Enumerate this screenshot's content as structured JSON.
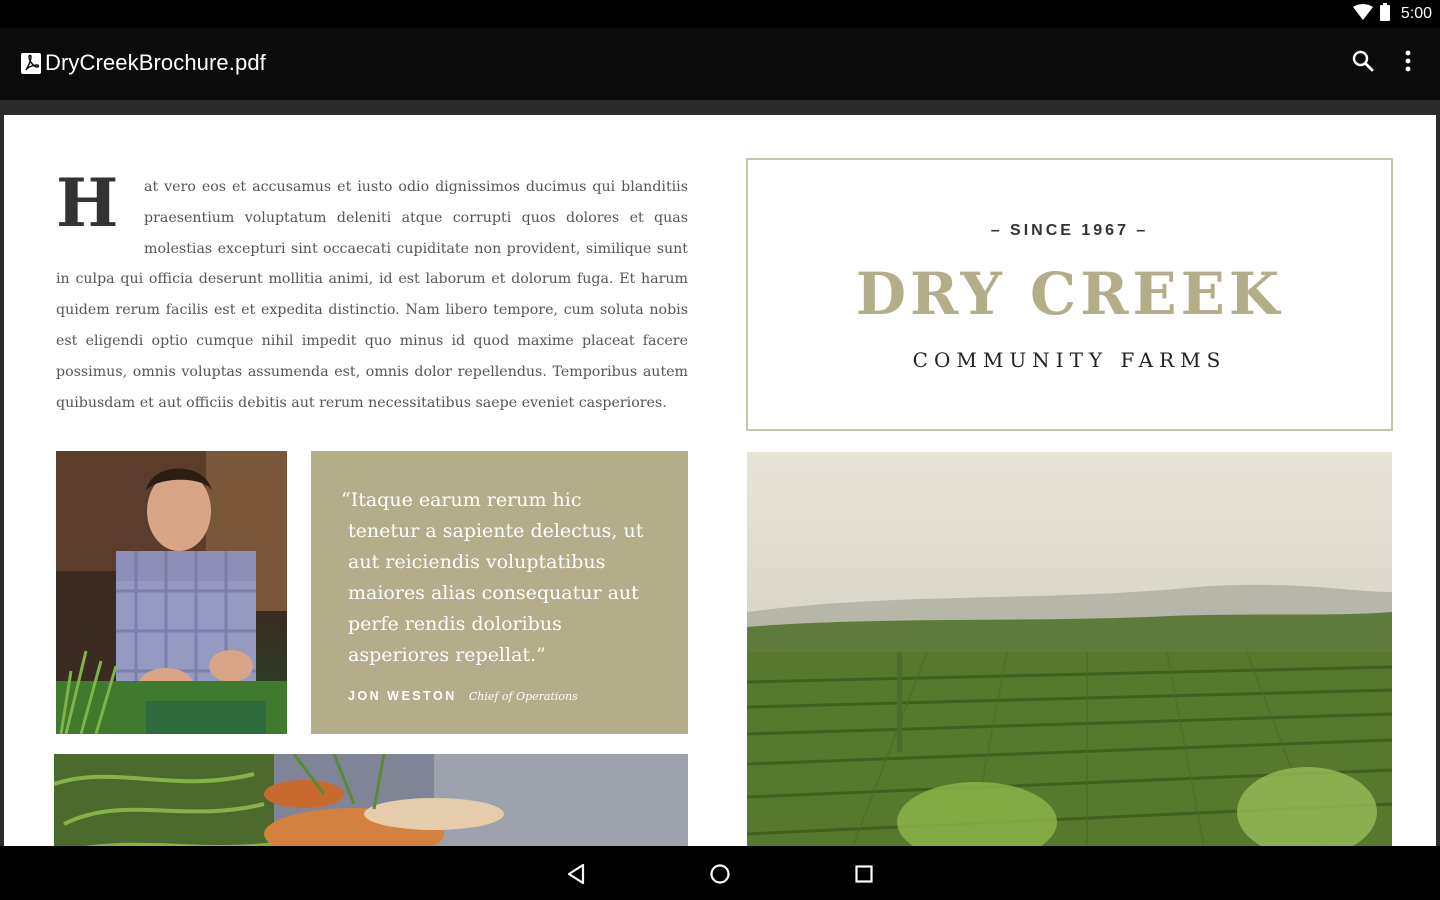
{
  "status_bar": {
    "time": "5:00",
    "icons": [
      "wifi-icon",
      "battery-icon"
    ]
  },
  "app_bar": {
    "file_icon": "pdf-icon",
    "title": "DryCreekBrochure.pdf",
    "actions": [
      "search-icon",
      "more-vert-icon"
    ]
  },
  "document": {
    "article": {
      "drop_cap": "H",
      "body": "at vero eos et accusamus et iusto odio dignissimos ducimus qui blanditiis praesentium voluptatum deleniti atque corrupti quos dolores et quas molestias excepturi sint occaecati cupiditate non provident, similique sunt in culpa qui officia deserunt mollitia animi, id est laborum et dolorum fuga. Et harum quidem rerum facilis est et expedita distinctio. Nam libero tempore, cum soluta nobis est eligendi optio cumque nihil impedit quo minus id quod maxime placeat facere possimus, omnis voluptas assumenda est, omnis dolor repellendus. Temporibus autem quibusdam et aut officiis debitis aut rerum necessitatibus saepe eveniet casperiores."
    },
    "quote": {
      "text": "“Itaque earum rerum hic tenetur a sapiente delectus, ut aut reiciendis voluptatibus maiores alias consequatur aut perfe rendis doloribus asperiores repellat.”",
      "name": "JON WESTON",
      "role": "Chief of Operations"
    },
    "logo": {
      "since": "– SINCE 1967 –",
      "name": "DRY CREEK",
      "subtitle": "COMMUNITY FARMS"
    },
    "colors": {
      "accent": "#b3ad89",
      "border": "#c9c4a6",
      "body_text": "#555555"
    }
  },
  "nav_bar": {
    "buttons": [
      "back-icon",
      "home-icon",
      "recents-icon"
    ]
  }
}
